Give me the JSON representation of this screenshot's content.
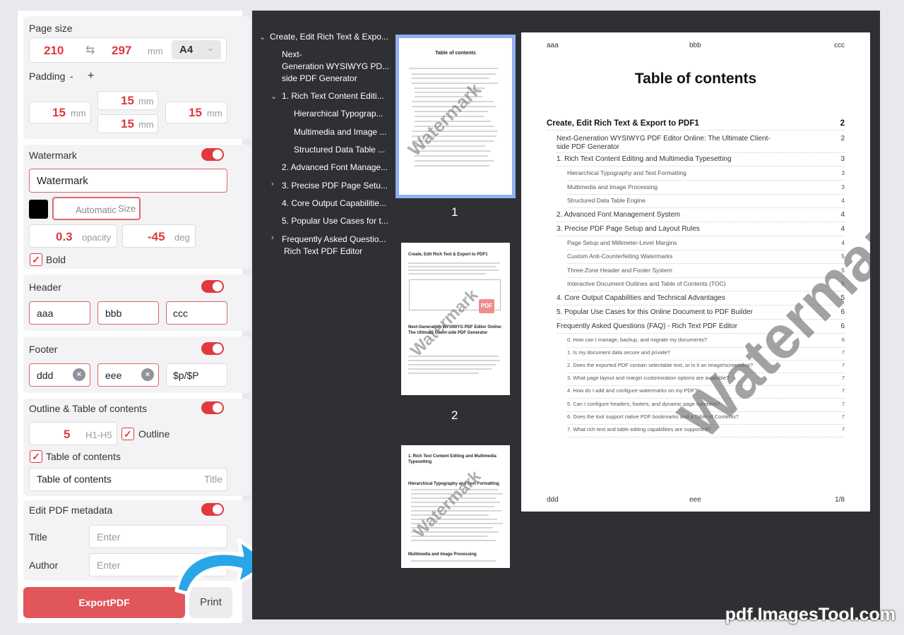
{
  "settings": {
    "page_size": {
      "label": "Page size",
      "width": "210",
      "height": "297",
      "unit": "mm",
      "preset": "A4"
    },
    "padding": {
      "label": "Padding",
      "minus": "-",
      "plus": "+",
      "left": "15",
      "top": "15",
      "bottom": "15",
      "right": "15",
      "unit": "mm"
    },
    "watermark": {
      "label": "Watermark",
      "text": "Watermark",
      "color": "#000000",
      "size_value": "Automatic",
      "size_label": "Size",
      "opacity": "0.3",
      "opacity_unit": "opacity",
      "angle": "-45",
      "angle_unit": "deg",
      "bold_label": "Bold",
      "bold_mark": "✓"
    },
    "header": {
      "label": "Header",
      "left": "aaa",
      "center": "bbb",
      "right": "ccc"
    },
    "footer": {
      "label": "Footer",
      "left": "ddd",
      "center": "eee",
      "right": "$p/$P",
      "clear_icon": "×"
    },
    "outline": {
      "label": "Outline & Table of contents",
      "level": "5",
      "level_unit": "H1-H5",
      "outline_label": "Outline",
      "toc_label": "Table of contents",
      "toc_title": "Table of contents",
      "toc_title_hint": "Title",
      "check_mark": "✓"
    },
    "metadata": {
      "label": "Edit PDF metadata",
      "title_label": "Title",
      "title_placeholder": "Enter",
      "author_label": "Author",
      "author_placeholder": "Enter"
    },
    "actions": {
      "export": "ExportPDF",
      "print": "Print"
    },
    "accent_color": "#e0393e"
  },
  "outline_tree": [
    {
      "text": "Create, Edit Rich Text & Expo..."
    },
    {
      "text": "Next-"
    },
    {
      "text": "Generation WYSIWYG PD..."
    },
    {
      "text": "side PDF Generator"
    },
    {
      "text": "1. Rich Text Content Editi..."
    },
    {
      "text": "Hierarchical Typograp..."
    },
    {
      "text": "Multimedia and Image ..."
    },
    {
      "text": "Structured Data Table ..."
    },
    {
      "text": "2. Advanced Font Manage..."
    },
    {
      "text": "3. Precise PDF Page Setu..."
    },
    {
      "text": "4. Core Output Capabilitie..."
    },
    {
      "text": "5. Popular Use Cases for t..."
    },
    {
      "text": "Frequently Asked Questio..."
    },
    {
      "text": "Rich Text PDF Editor"
    }
  ],
  "thumbnails": {
    "pages": [
      "1",
      "2"
    ],
    "t1_title": "Table of contents",
    "t2_title": "Create, Edit Rich Text & Export to PDF1",
    "t2_sub": "Next-Generation WYSIWYG PDF Editor Online: The Ultimate Client-side PDF Generator",
    "t2_badge": "PDF",
    "t3_title": "1. Rich Text Content Editing and Multimedia Typesetting",
    "t3_sub1": "Hierarchical Typography and Text Formatting",
    "t3_sub2": "Multimedia and Image Processing",
    "watermark": "Watermark"
  },
  "page": {
    "header_left": "aaa",
    "header_center": "bbb",
    "header_right": "ccc",
    "title": "Table of contents",
    "footer_left": "ddd",
    "footer_center": "eee",
    "footer_right": "1/8",
    "watermark": "Watermark",
    "toc": [
      {
        "text": "Create, Edit Rich Text & Export to PDF1",
        "page": "2",
        "level": 1
      },
      {
        "text": "Next-Generation WYSIWYG PDF Editor Online: The Ultimate Client-side PDF Generator",
        "page": "2",
        "level": 2
      },
      {
        "text": "1. Rich Text Content Editing and Multimedia Typesetting",
        "page": "3",
        "level": 2
      },
      {
        "text": "Hierarchical Typography and Text Formatting",
        "page": "3",
        "level": 3
      },
      {
        "text": "Multimedia and Image Processing",
        "page": "3",
        "level": 3
      },
      {
        "text": "Structured Data Table Engine",
        "page": "4",
        "level": 3
      },
      {
        "text": "2. Advanced Font Management System",
        "page": "4",
        "level": 2
      },
      {
        "text": "3. Precise PDF Page Setup and Layout Rules",
        "page": "4",
        "level": 2
      },
      {
        "text": "Page Setup and Millimeter-Level Margins",
        "page": "4",
        "level": 3
      },
      {
        "text": "Custom Anti-Counterfeiting Watermarks",
        "page": "5",
        "level": 3
      },
      {
        "text": "Three-Zone Header and Footer System",
        "page": "5",
        "level": 3
      },
      {
        "text": "Interactive Document Outlines and Table of Contents (TOC)",
        "page": "5",
        "level": 3
      },
      {
        "text": "4. Core Output Capabilities and Technical Advantages",
        "page": "5",
        "level": 2
      },
      {
        "text": "5. Popular Use Cases for this Online Document to PDF Builder",
        "page": "6",
        "level": 2
      },
      {
        "text": "Frequently Asked Questions (FAQ) - Rich Text PDF Editor",
        "page": "6",
        "level": 2
      },
      {
        "text": "0. How can I manage, backup, and migrate my documents?",
        "page": "6",
        "level": 4
      },
      {
        "text": "1. Is my document data secure and private?",
        "page": "7",
        "level": 4
      },
      {
        "text": "2. Does the exported PDF contain selectable text, or is it an image/screenshot?",
        "page": "7",
        "level": 4
      },
      {
        "text": "3. What page layout and margin customization options are available?",
        "page": "7",
        "level": 4
      },
      {
        "text": "4. How do I add and configure watermarks on my PDF?",
        "page": "7",
        "level": 4
      },
      {
        "text": "5. Can I configure headers, footers, and dynamic page numbers?",
        "page": "7",
        "level": 4
      },
      {
        "text": "6. Does the tool support native PDF bookmarks and a Table of Contents?",
        "page": "7",
        "level": 4
      },
      {
        "text": "7. What rich text and table editing capabilities are supported?",
        "page": "7",
        "level": 4
      }
    ]
  },
  "brand": "pdf.ImagesTool.com"
}
